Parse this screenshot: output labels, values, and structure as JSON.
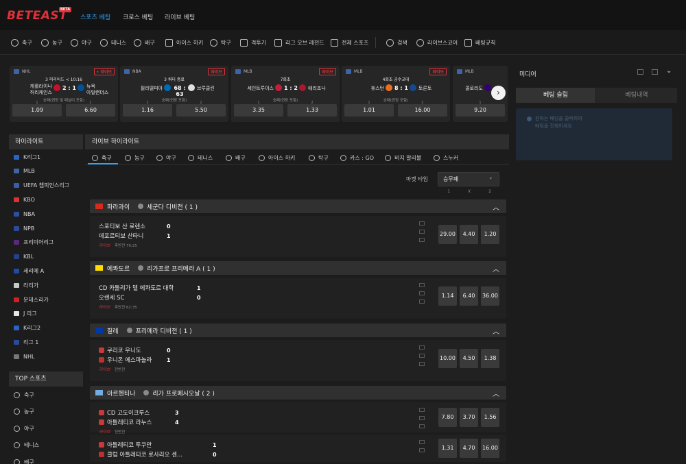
{
  "header": {
    "logo": "BETEAST",
    "logo_badge": "BETA",
    "nav": [
      "스포츠 베팅",
      "크로스 베팅",
      "라이브 베팅"
    ]
  },
  "sportbar": [
    "축구",
    "농구",
    "야구",
    "테니스",
    "배구",
    "아이스 하키",
    "탁구",
    "격투기",
    "리그 오브 레전드",
    "전체 스포츠",
    "검색",
    "라이브스코어",
    "베팅규칙"
  ],
  "live_cards": [
    {
      "league": "NHL",
      "status": "3 피리어드 < 10:16",
      "home": [
        "캐롤라이나",
        "허리케인스"
      ],
      "score": "2 : 1",
      "away": [
        "뉴욕",
        "아일랜더스"
      ],
      "note": "승패(연장 및 페널티 포함)",
      "odds": [
        "1.09",
        "6.60"
      ],
      "labels": [
        "1",
        "2"
      ],
      "live": "• 라이브",
      "home_color": "#c8102e",
      "away_color": "#00539b"
    },
    {
      "league": "NBA",
      "status": "3 쿼터 종료",
      "home": [
        "필라델피아"
      ],
      "score": "68 : 63",
      "away": [
        "브루클린"
      ],
      "note": "승패(연장 포함)",
      "odds": [
        "1.16",
        "5.50"
      ],
      "labels": [
        "1",
        "2"
      ],
      "live": "라이브",
      "home_color": "#006bb6",
      "away_color": "#e0e0e0"
    },
    {
      "league": "MLB",
      "status": "7회초",
      "home": [
        "세인트루이스"
      ],
      "score": "1 : 2",
      "away": [
        "애리조나"
      ],
      "note": "승패(연장 포함)",
      "odds": [
        "3.35",
        "1.33"
      ],
      "labels": [
        "1",
        "2"
      ],
      "live": "라이브",
      "home_color": "#c41e3a",
      "away_color": "#a71930"
    },
    {
      "league": "MLB",
      "status": "4회초 공수교대",
      "home": [
        "휴스턴"
      ],
      "score": "8 : 1",
      "away": [
        "토론토"
      ],
      "note": "승패(연장 포함)",
      "odds": [
        "1.01",
        "16.00"
      ],
      "labels": [
        "1",
        "2"
      ],
      "live": "라이브",
      "home_color": "#eb6e1f",
      "away_color": "#134a8e"
    },
    {
      "league": "MLB",
      "status": "",
      "home": [
        "콜로라도"
      ],
      "score": "",
      "away": [],
      "note": "승패",
      "odds": [
        "9.20",
        ""
      ],
      "labels": [
        "1",
        ""
      ],
      "live": "",
      "home_color": "#33006f",
      "away_color": "#333333"
    }
  ],
  "media": {
    "title": "미디어",
    "tabs": [
      "베팅 슬립",
      "베팅내역"
    ],
    "info_lines": [
      "원하는 배당을 클릭하여",
      "베팅을 진행하세요"
    ]
  },
  "sidebar": {
    "highlight_title": "하이라이트",
    "highlights": [
      "K리그1",
      "MLB",
      "UEFA 챔피언스리그",
      "KBO",
      "NBA",
      "NPB",
      "프리미어리그",
      "KBL",
      "세리에 A",
      "라리가",
      "분데스리가",
      "J 리그",
      "K리그2",
      "리그 1",
      "NHL"
    ],
    "top_title": "TOP 스포츠",
    "top": [
      "축구",
      "농구",
      "야구",
      "테니스",
      "배구"
    ]
  },
  "main": {
    "title": "라이브 하이라이트",
    "tabs": [
      "축구",
      "농구",
      "야구",
      "테니스",
      "배구",
      "아이스 하키",
      "탁구",
      "카스 : GO",
      "비치 발리볼",
      "스누커"
    ],
    "market_label": "마켓 타입",
    "market_value": "승무패",
    "col_headers": [
      "1",
      "X",
      "2"
    ],
    "leagues": [
      {
        "country": "파라과이",
        "name": "세군다 디비전 ( 1 )",
        "flag": "#d52b1e",
        "matches": [
          {
            "home": "스포티보 산 로렌소",
            "away": "데포르티보 산타니",
            "home_score": "0",
            "away_score": "1",
            "live": "라이브",
            "meta": "후반전 79:25",
            "odds": [
              "29.00",
              "4.40",
              "1.20"
            ]
          }
        ]
      },
      {
        "country": "에콰도르",
        "name": "리가프로 프리메라 A ( 1 )",
        "flag": "#ffdd00",
        "matches": [
          {
            "home": "CD 카톨리가 델 에콰도르 대학",
            "away": "오렌세 SC",
            "home_score": "1",
            "away_score": "0",
            "live": "라이브",
            "meta": "후반전 62:35",
            "odds": [
              "1.14",
              "6.40",
              "36.00"
            ]
          }
        ]
      },
      {
        "country": "칠레",
        "name": "프리메라 디비전 ( 1 )",
        "flag": "#0039a6",
        "matches": [
          {
            "home": "쿠리코 우니도",
            "away": "우니온 에스파놀라",
            "home_score": "0",
            "away_score": "1",
            "live": "라이브",
            "meta": "전반전",
            "odds": [
              "10.00",
              "4.50",
              "1.38"
            ]
          }
        ]
      },
      {
        "country": "아르헨티나",
        "name": "리가 프로페시오날 ( 2 )",
        "flag": "#74acdf",
        "matches": [
          {
            "home": "CD 고도이크루스",
            "away": "아틀레티코 라누스",
            "home_score": "3",
            "away_score": "4",
            "live": "라이브",
            "meta": "전반전",
            "odds": [
              "7.80",
              "3.70",
              "1.56"
            ]
          },
          {
            "home": "아틀레티코 투쿠만",
            "away": "클럽 아틀레티코 로사리오 센...",
            "home_score": "1",
            "away_score": "0",
            "live": "",
            "meta": "",
            "odds": [
              "1.31",
              "4.70",
              "16.00"
            ]
          }
        ]
      }
    ]
  }
}
